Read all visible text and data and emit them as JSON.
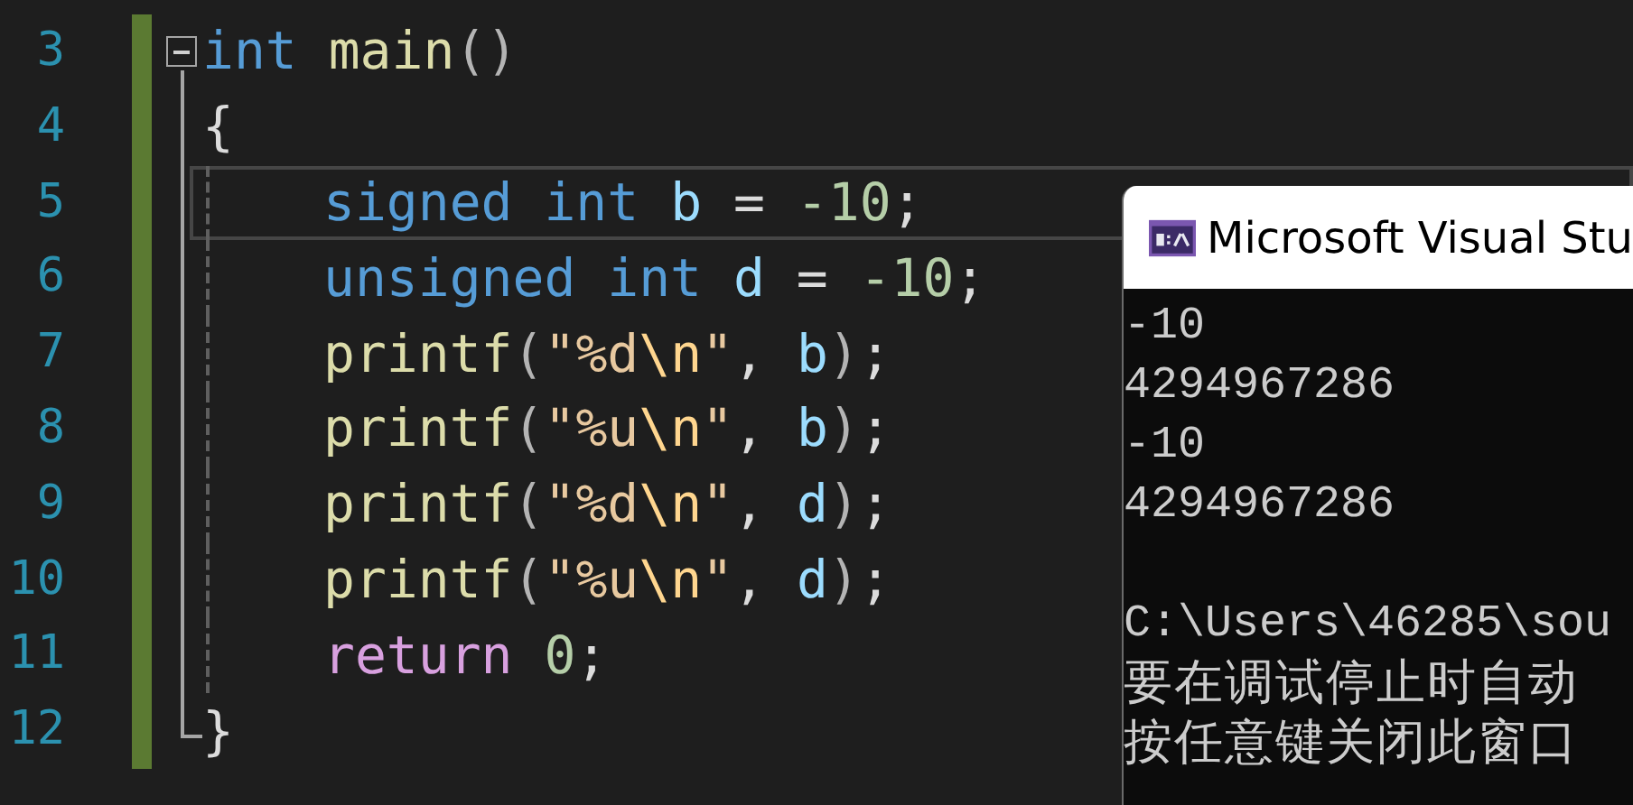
{
  "editor": {
    "lines": [
      {
        "number": "3",
        "changed": true,
        "indented": false,
        "current": false,
        "tokens": [
          {
            "text": "int ",
            "kind": "keyword"
          },
          {
            "text": "main",
            "kind": "function"
          },
          {
            "text": "()",
            "kind": "paren"
          }
        ],
        "children": [
          {
            "number": "4",
            "changed": true,
            "indented": false,
            "current": false,
            "tokens": [
              {
                "text": "{",
                "kind": "punct"
              }
            ]
          },
          {
            "number": "5",
            "changed": true,
            "indented": true,
            "current": true,
            "tokens": [
              {
                "text": "signed int ",
                "kind": "keyword"
              },
              {
                "text": "b",
                "kind": "variable"
              },
              {
                "text": " = ",
                "kind": "punct"
              },
              {
                "text": "-10",
                "kind": "number"
              },
              {
                "text": ";",
                "kind": "punct"
              }
            ]
          },
          {
            "number": "6",
            "changed": true,
            "indented": true,
            "current": false,
            "tokens": [
              {
                "text": "unsigned int ",
                "kind": "keyword"
              },
              {
                "text": "d",
                "kind": "variable"
              },
              {
                "text": " = ",
                "kind": "punct"
              },
              {
                "text": "-10",
                "kind": "number"
              },
              {
                "text": ";",
                "kind": "punct"
              }
            ]
          },
          {
            "number": "7",
            "changed": true,
            "indented": true,
            "current": false,
            "tokens": [
              {
                "text": "printf",
                "kind": "function"
              },
              {
                "text": "(",
                "kind": "paren"
              },
              {
                "text": "\"%d",
                "kind": "string"
              },
              {
                "text": "\\n",
                "kind": "escape"
              },
              {
                "text": "\"",
                "kind": "string"
              },
              {
                "text": ", ",
                "kind": "punct"
              },
              {
                "text": "b",
                "kind": "variable"
              },
              {
                "text": ")",
                "kind": "paren"
              },
              {
                "text": ";",
                "kind": "punct"
              }
            ]
          },
          {
            "number": "8",
            "changed": true,
            "indented": true,
            "current": false,
            "tokens": [
              {
                "text": "printf",
                "kind": "function"
              },
              {
                "text": "(",
                "kind": "paren"
              },
              {
                "text": "\"%u",
                "kind": "string"
              },
              {
                "text": "\\n",
                "kind": "escape"
              },
              {
                "text": "\"",
                "kind": "string"
              },
              {
                "text": ", ",
                "kind": "punct"
              },
              {
                "text": "b",
                "kind": "variable"
              },
              {
                "text": ")",
                "kind": "paren"
              },
              {
                "text": ";",
                "kind": "punct"
              }
            ]
          },
          {
            "number": "9",
            "changed": true,
            "indented": true,
            "current": false,
            "tokens": [
              {
                "text": "printf",
                "kind": "function"
              },
              {
                "text": "(",
                "kind": "paren"
              },
              {
                "text": "\"%d",
                "kind": "string"
              },
              {
                "text": "\\n",
                "kind": "escape"
              },
              {
                "text": "\"",
                "kind": "string"
              },
              {
                "text": ", ",
                "kind": "punct"
              },
              {
                "text": "d",
                "kind": "variable"
              },
              {
                "text": ")",
                "kind": "paren"
              },
              {
                "text": ";",
                "kind": "punct"
              }
            ]
          },
          {
            "number": "10",
            "changed": true,
            "indented": true,
            "current": false,
            "tokens": [
              {
                "text": "printf",
                "kind": "function"
              },
              {
                "text": "(",
                "kind": "paren"
              },
              {
                "text": "\"%u",
                "kind": "string"
              },
              {
                "text": "\\n",
                "kind": "escape"
              },
              {
                "text": "\"",
                "kind": "string"
              },
              {
                "text": ", ",
                "kind": "punct"
              },
              {
                "text": "d",
                "kind": "variable"
              },
              {
                "text": ")",
                "kind": "paren"
              },
              {
                "text": ";",
                "kind": "punct"
              }
            ]
          },
          {
            "number": "11",
            "changed": true,
            "indented": true,
            "current": false,
            "tokens": [
              {
                "text": "return ",
                "kind": "control"
              },
              {
                "text": "0",
                "kind": "number"
              },
              {
                "text": ";",
                "kind": "punct"
              }
            ]
          },
          {
            "number": "12",
            "changed": true,
            "indented": false,
            "current": false,
            "tokens": [
              {
                "text": "}",
                "kind": "punct"
              }
            ]
          }
        ]
      }
    ]
  },
  "console": {
    "title": "Microsoft Visual Stu",
    "output": [
      "-10",
      "4294967286",
      "-10",
      "4294967286"
    ],
    "messages": [
      "C:\\Users\\46285\\sou",
      "要在调试停止时自动",
      "按任意键关闭此窗口"
    ]
  }
}
